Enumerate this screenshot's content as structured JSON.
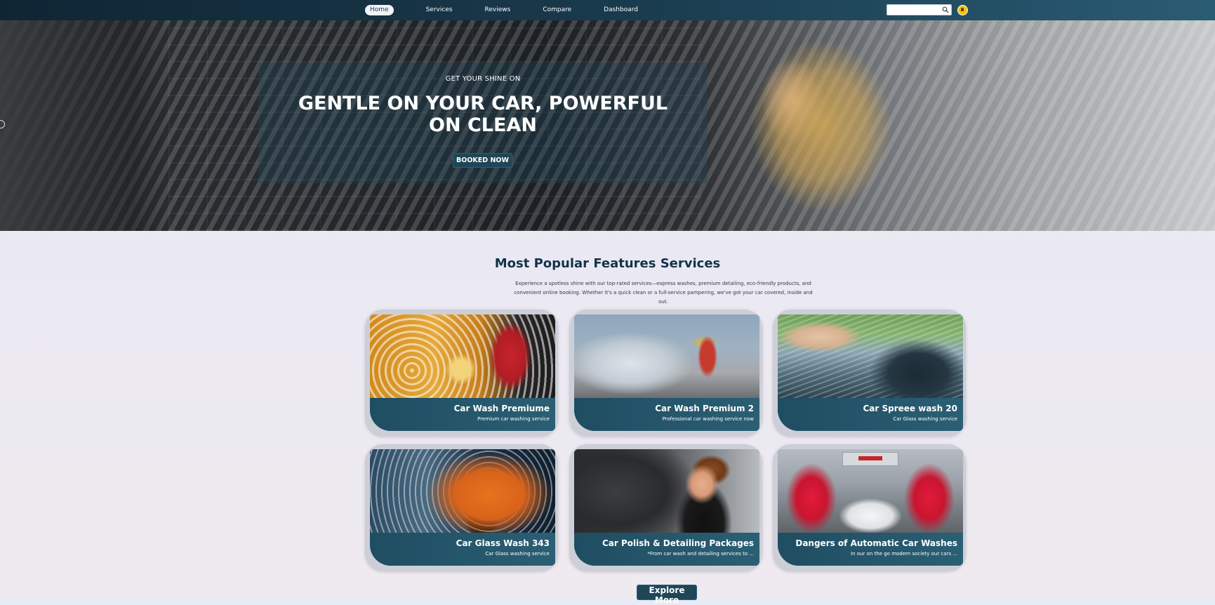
{
  "nav": {
    "items": [
      {
        "label": "Home",
        "active": true
      },
      {
        "label": "Services",
        "active": false
      },
      {
        "label": "Reviews",
        "active": false
      },
      {
        "label": "Compare",
        "active": false
      },
      {
        "label": "Dashboard",
        "active": false
      }
    ],
    "search_placeholder": "",
    "search_icon": "search-icon",
    "avatar_icon": "user-avatar-icon"
  },
  "hero": {
    "eyebrow": "GET YOUR SHINE ON",
    "headline": "GENTLE ON YOUR CAR, POWERFUL ON CLEAN",
    "cta_label": "BOOKED NOW"
  },
  "services": {
    "title": "Most Popular Features Services",
    "description": "Experience a spotless shine with our top-rated services—express washes, premium detailing, eco-friendly products, and convenient online booking. Whether it's a quick clean or a full-service pampering, we've got your car covered, inside and out.",
    "cards": [
      {
        "title": "Car Wash Premiume",
        "subtitle": "Premium car washing service"
      },
      {
        "title": "Car Wash Premium 2",
        "subtitle": "Professional car washing service now"
      },
      {
        "title": "Car Spreee wash 20",
        "subtitle": "Car Glass washing service"
      },
      {
        "title": "Car Glass Wash 343",
        "subtitle": "Car Glass washing service"
      },
      {
        "title": "Car Polish & Detailing Packages",
        "subtitle": "*From car wash and detailing services to ..."
      },
      {
        "title": "Dangers of Automatic Car Washes",
        "subtitle": "In our on the go modern society our cars ..."
      }
    ],
    "explore_label": "Explore More"
  },
  "colors": {
    "nav_dark": "#0f2534",
    "nav_light": "#2a5c74",
    "accent_button": "#1f4657",
    "card_footer": "#2b5f74",
    "title_text": "#14324a"
  }
}
